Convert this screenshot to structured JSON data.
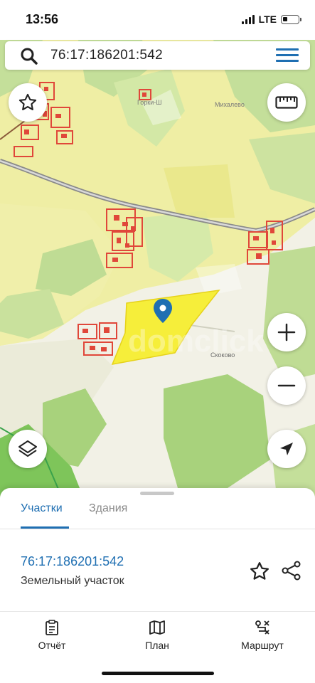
{
  "status_bar": {
    "time": "13:56",
    "network": "LTE",
    "battery_level": 0.3
  },
  "search": {
    "query": "76:17:186201:542"
  },
  "map": {
    "place_labels": [
      "Горки-Ш",
      "Михалево",
      "Скоково"
    ],
    "watermark": "domclick",
    "colors": {
      "background": "#f2f1e6",
      "farmland": "#efeea4",
      "forest": "#c4df9a",
      "forest_dark": "#8fce6c",
      "buildings": "#e0473a",
      "selected_parcel": "#f6ee3a",
      "pin": "#1f6fb2"
    },
    "controls": [
      "favorite-button",
      "ruler-button",
      "zoom-in-button",
      "zoom-out-button",
      "layers-button",
      "locate-button"
    ]
  },
  "sheet": {
    "tabs": [
      {
        "label": "Участки",
        "active": true
      },
      {
        "label": "Здания",
        "active": false
      }
    ],
    "parcel": {
      "number": "76:17:186201:542",
      "type": "Земельный участок"
    }
  },
  "bottom_nav": {
    "items": [
      {
        "label": "Отчёт",
        "icon": "report-icon"
      },
      {
        "label": "План",
        "icon": "map-plan-icon"
      },
      {
        "label": "Маршрут",
        "icon": "route-icon"
      }
    ]
  }
}
